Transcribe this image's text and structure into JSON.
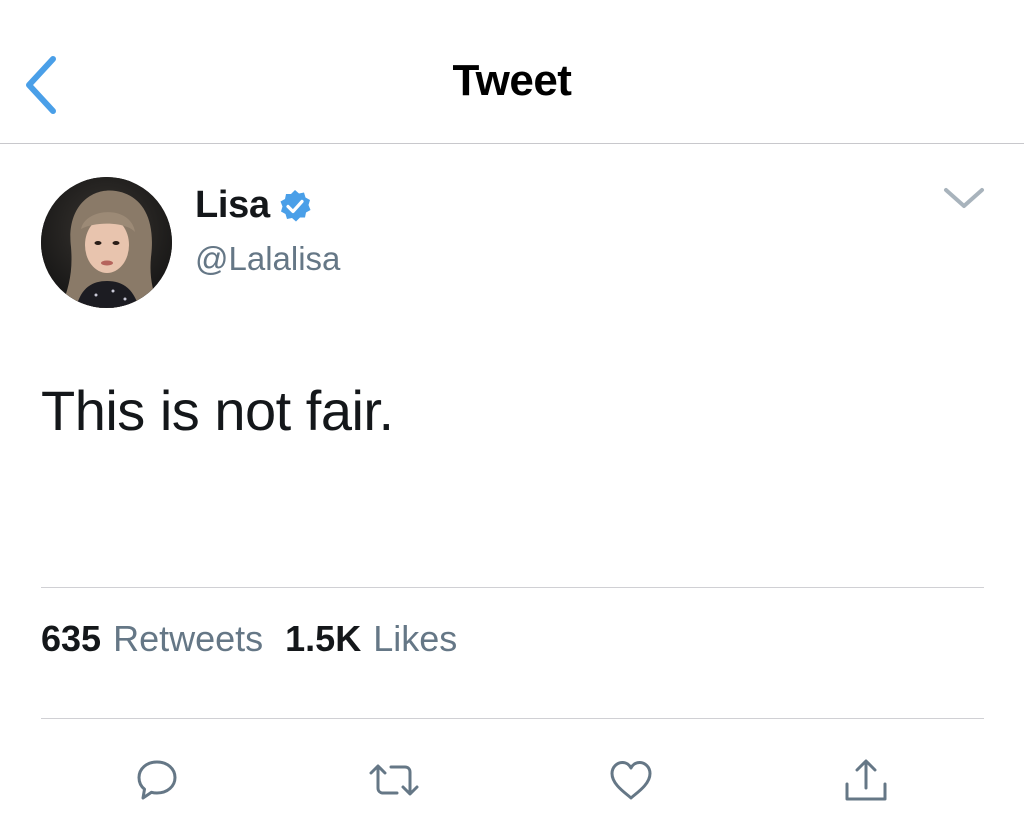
{
  "header": {
    "title": "Tweet",
    "back_icon": "chevron-left-icon"
  },
  "tweet": {
    "author": {
      "name": "Lisa",
      "handle": "@Lalalisa",
      "verified": true
    },
    "text": "This is not fair.",
    "stats": {
      "retweets_count": "635",
      "retweets_label": "Retweets",
      "likes_count": "1.5K",
      "likes_label": "Likes"
    }
  },
  "actions": [
    {
      "name": "reply",
      "icon": "speech-bubble-icon"
    },
    {
      "name": "retweet",
      "icon": "retweet-icon"
    },
    {
      "name": "like",
      "icon": "heart-icon"
    },
    {
      "name": "share",
      "icon": "share-icon"
    }
  ],
  "colors": {
    "accent": "#4a9fe8",
    "text_primary": "#14171a",
    "text_secondary": "#657786",
    "icon_gray": "#657786",
    "divider": "#d0d0d4"
  }
}
